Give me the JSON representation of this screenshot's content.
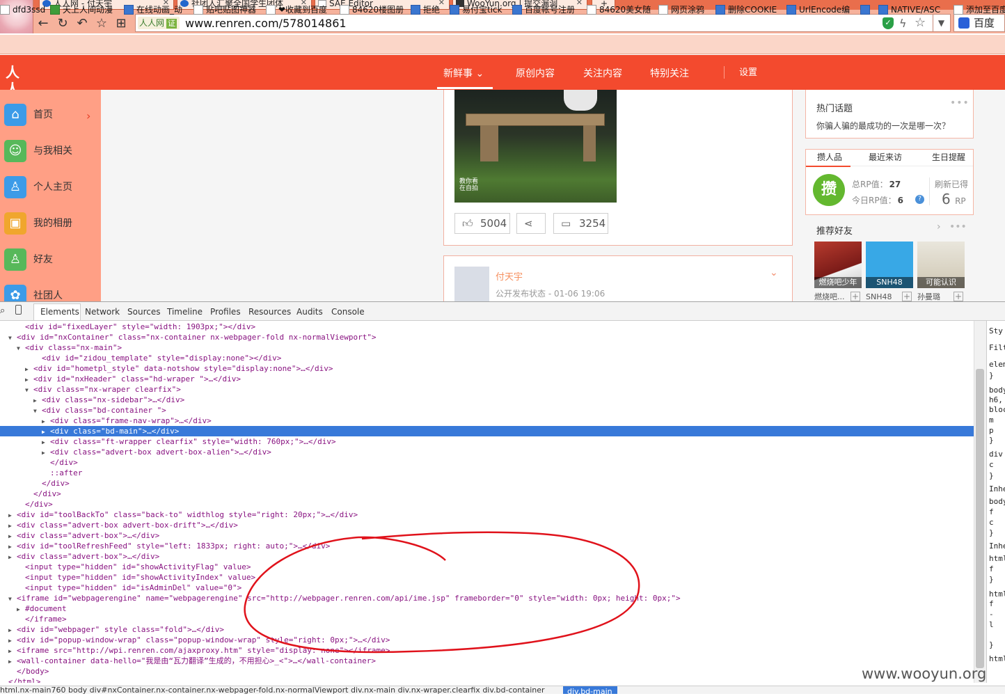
{
  "browser": {
    "tabs": [
      {
        "label": "人人网 - 付天宇"
      },
      {
        "label": "社团人汇聚全国学生团体"
      },
      {
        "label": "SAE Editor"
      },
      {
        "label": "WooYun.org | 提交漏洞"
      }
    ],
    "new_tab": "+",
    "url_badge": "人人网",
    "url_badge_verified": "证",
    "url": "www.renren.com/578014861",
    "search_engine": "百度",
    "bookmarks": [
      {
        "label": "dfd3ssd"
      },
      {
        "label": "天上人间动漫"
      },
      {
        "label": "在线动画_动"
      },
      {
        "label": "贴吧贴图神器"
      },
      {
        "label": "❤收藏到百度"
      },
      {
        "label": "84620楼图册"
      },
      {
        "label": "拒绝"
      },
      {
        "label": "易付宝tick"
      },
      {
        "label": "百度帐号注册"
      },
      {
        "label": "84620美女随"
      },
      {
        "label": "网页涂鸦"
      },
      {
        "label": "删除COOKIE"
      },
      {
        "label": "UrlEncode编"
      },
      {
        "label": "NATIVE/ASC"
      },
      {
        "label": "添加至百度"
      }
    ]
  },
  "renren": {
    "logo": "人人",
    "nav": [
      {
        "label": "新鲜事 ⌄"
      },
      {
        "label": "原创内容"
      },
      {
        "label": "关注内容"
      },
      {
        "label": "特别关注"
      },
      {
        "label": "设置"
      }
    ],
    "sidebar": [
      {
        "label": "首页",
        "color": "#3c9be8"
      },
      {
        "label": "与我相关",
        "color": "#57b85a"
      },
      {
        "label": "个人主页",
        "color": "#3c9be8"
      },
      {
        "label": "我的相册",
        "color": "#f0a62d"
      },
      {
        "label": "好友",
        "color": "#57b85a"
      },
      {
        "label": "社团人",
        "color": "#3c9be8"
      }
    ],
    "feed": {
      "photo_watermark": "教你看\n在自拍",
      "likes": "5004",
      "comments": "3254",
      "next_author": "付天宇",
      "next_meta": "公开发布状态 - 01-06 19:06"
    },
    "right": {
      "hot_title": "热门话题",
      "hot_text": "你骗人骗的最成功的一次是哪一次？",
      "tabs": [
        "攒人品",
        "最近来访",
        "生日提醒"
      ],
      "rp_badge": "攒",
      "total_rp_label": "总RP值：",
      "total_rp": "27",
      "today_rp_label": "今日RP值：",
      "today_rp": "6",
      "refresh_label": "刷新已得",
      "refresh_value": "6",
      "refresh_unit": "RP",
      "recommend_title": "推荐好友",
      "friends": [
        {
          "caption": "燃烧吧少年",
          "name": "燃烧吧..."
        },
        {
          "caption": "SNH48",
          "name": "SNH48"
        },
        {
          "caption": "可能认识",
          "name": "孙曼璐"
        }
      ]
    }
  },
  "devtools": {
    "tabs": [
      "Elements",
      "Network",
      "Sources",
      "Timeline",
      "Profiles",
      "Resources",
      "Audits",
      "Console"
    ],
    "lines": [
      {
        "indent": 2,
        "arrow": "",
        "text": "<div id=\"fixedLayer\" style=\"width: 1903px;\"></div>"
      },
      {
        "indent": 1,
        "arrow": "▼",
        "text": "<div id=\"nxContainer\" class=\"nx-container nx-webpager-fold nx-normalViewport\">"
      },
      {
        "indent": 2,
        "arrow": "▼",
        "text": "<div class=\"nx-main\">"
      },
      {
        "indent": 4,
        "arrow": "",
        "text": "<div id=\"zidou_template\" style=\"display:none\"></div>"
      },
      {
        "indent": 3,
        "arrow": "▶",
        "text": "<div id=\"hometpl_style\" data-notshow style=\"display:none\">…</div>"
      },
      {
        "indent": 3,
        "arrow": "▶",
        "text": "<div id=\"nxHeader\" class=\"hd-wraper \">…</div>"
      },
      {
        "indent": 3,
        "arrow": "▼",
        "text": "<div class=\"nx-wraper clearfix\">"
      },
      {
        "indent": 4,
        "arrow": "▶",
        "text": "<div class=\"nx-sidebar\">…</div>"
      },
      {
        "indent": 4,
        "arrow": "▼",
        "text": "<div class=\"bd-container \">"
      },
      {
        "indent": 5,
        "arrow": "▶",
        "text": "<div class=\"frame-nav-wrap\">…</div>"
      },
      {
        "indent": 5,
        "arrow": "▶",
        "text": "<div class=\"bd-main\">…</div>",
        "selected": true
      },
      {
        "indent": 5,
        "arrow": "▶",
        "text": "<div class=\"ft-wrapper clearfix\" style=\"width: 760px;\">…</div>"
      },
      {
        "indent": 5,
        "arrow": "▶",
        "text": "<div class=\"advert-box advert-box-alien\">…</div>"
      },
      {
        "indent": 5,
        "arrow": "",
        "text": "</div>"
      },
      {
        "indent": 5,
        "arrow": "",
        "text": "::after"
      },
      {
        "indent": 4,
        "arrow": "",
        "text": "</div>"
      },
      {
        "indent": 3,
        "arrow": "",
        "text": "</div>"
      },
      {
        "indent": 2,
        "arrow": "",
        "text": "</div>"
      },
      {
        "indent": 1,
        "arrow": "▶",
        "text": "<div id=\"toolBackTo\" class=\"back-to\" widthlog style=\"right: 20px;\">…</div>"
      },
      {
        "indent": 1,
        "arrow": "▶",
        "text": "<div class=\"advert-box advert-box-drift\">…</div>"
      },
      {
        "indent": 1,
        "arrow": "▶",
        "text": "<div class=\"advert-box\">…</div>"
      },
      {
        "indent": 1,
        "arrow": "▶",
        "text": "<div id=\"toolRefreshFeed\" style=\"left: 1833px; right: auto;\">…</div>"
      },
      {
        "indent": 1,
        "arrow": "▶",
        "text": "<div class=\"advert-box\">…</div>"
      },
      {
        "indent": 2,
        "arrow": "",
        "text": "<input type=\"hidden\" id=\"showActivityFlag\" value>"
      },
      {
        "indent": 2,
        "arrow": "",
        "text": "<input type=\"hidden\" id=\"showActivityIndex\" value>"
      },
      {
        "indent": 2,
        "arrow": "",
        "text": "<input type=\"hidden\" id=\"isAdminDel\" value=\"0\">"
      },
      {
        "indent": 1,
        "arrow": "▼",
        "text": "<iframe id=\"webpagerengine\" name=\"webpagerengine\" src=\"http://webpager.renren.com/api/ime.jsp\" frameborder=\"0\" style=\"width: 0px; height: 0px;\">"
      },
      {
        "indent": 2,
        "arrow": "▶",
        "text": "#document"
      },
      {
        "indent": 2,
        "arrow": "",
        "text": "</iframe>"
      },
      {
        "indent": 1,
        "arrow": "▶",
        "text": "<div id=\"webpager\" style class=\"fold\">…</div>"
      },
      {
        "indent": 1,
        "arrow": "▶",
        "text": "<div id=\"popup-window-wrap\" class=\"popup-window-wrap\" style=\"right: 0px;\">…</div>"
      },
      {
        "indent": 1,
        "arrow": "▶",
        "text": "<iframe src=\"http://wpi.renren.com/ajaxproxy.htm\" style=\"display: none\"></iframe>"
      },
      {
        "indent": 1,
        "arrow": "▶",
        "text": "<wall-container data-hello=\"我是由“瓦力翻译”生成的，不用担心>_<\">…</wall-container>"
      },
      {
        "indent": 1,
        "arrow": "",
        "text": "</body>"
      },
      {
        "indent": 0,
        "arrow": "",
        "text": "</html>"
      }
    ],
    "style_pane": [
      "Sty",
      "Filte",
      "elem",
      "}",
      "body",
      "h6,",
      "bloc",
      "m",
      "p",
      "}",
      "div",
      "c",
      "}",
      "Inhe",
      "body",
      "f",
      "c",
      "}",
      "Inhe",
      "html",
      "f",
      "}",
      "html",
      "f",
      "-",
      "l",
      "}",
      "html"
    ],
    "breadcrumbs": "html.nx-main760    body    div#nxContainer.nx-container.nx-webpager-fold.nx-normalViewport    div.nx-main    div.nx-wraper.clearfix    div.bd-container",
    "breadcrumb_selected": "div.bd-main"
  },
  "watermark": "www.wooyun.org",
  "annotation_color": "#e0121b"
}
